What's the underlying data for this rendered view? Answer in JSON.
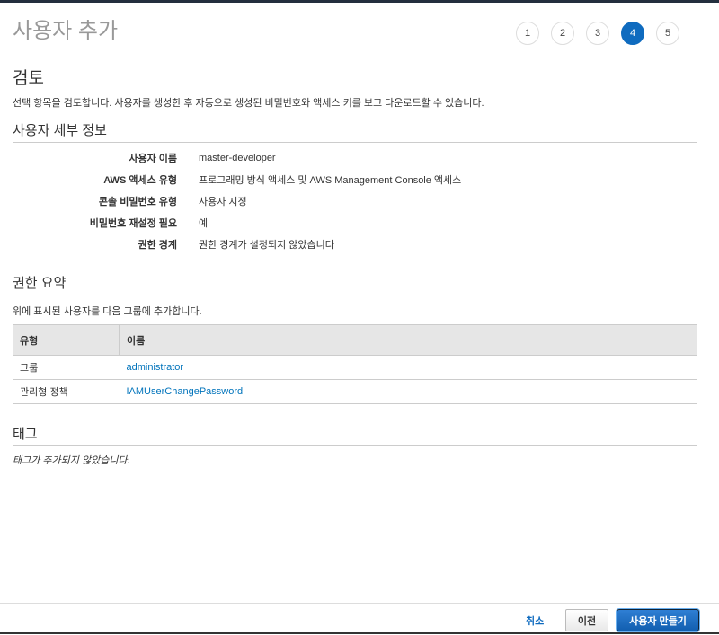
{
  "header": {
    "title": "사용자 추가",
    "steps": [
      "1",
      "2",
      "3",
      "4",
      "5"
    ],
    "active_step": "4"
  },
  "review": {
    "heading": "검토",
    "description": "선택 항목을 검토합니다. 사용자를 생성한 후 자동으로 생성된 비밀번호와 액세스 키를 보고 다운로드할 수 있습니다."
  },
  "details": {
    "heading": "사용자 세부 정보",
    "rows": [
      {
        "label": "사용자 이름",
        "value": "master-developer"
      },
      {
        "label": "AWS 액세스 유형",
        "value": "프로그래밍 방식 액세스 및 AWS Management Console 액세스"
      },
      {
        "label": "콘솔 비밀번호 유형",
        "value": "사용자 지정"
      },
      {
        "label": "비밀번호 재설정 필요",
        "value": "예"
      },
      {
        "label": "권한 경계",
        "value": "권한 경계가 설정되지 않았습니다"
      }
    ]
  },
  "permissions": {
    "heading": "권한 요약",
    "description": "위에 표시된 사용자를 다음 그룹에 추가합니다.",
    "columns": [
      "유형",
      "이름"
    ],
    "rows": [
      {
        "type": "그룹",
        "name": "administrator"
      },
      {
        "type": "관리형 정책",
        "name": "IAMUserChangePassword"
      }
    ]
  },
  "tags": {
    "heading": "태그",
    "empty": "태그가 추가되지 않았습니다."
  },
  "footer": {
    "cancel": "취소",
    "previous": "이전",
    "create": "사용자 만들기"
  }
}
